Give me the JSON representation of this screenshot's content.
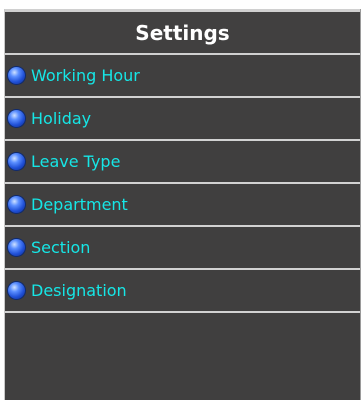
{
  "settings": {
    "title": "Settings",
    "items": [
      {
        "label": "Working Hour"
      },
      {
        "label": "Holiday"
      },
      {
        "label": "Leave Type"
      },
      {
        "label": "Department"
      },
      {
        "label": "Section"
      },
      {
        "label": "Designation"
      }
    ]
  },
  "colors": {
    "panel_bg": "#403f3f",
    "item_text": "#16e6e6",
    "header_text": "#ffffff",
    "divider": "#d2d2d2"
  },
  "icons": {
    "bullet": "blue-orb-icon"
  }
}
